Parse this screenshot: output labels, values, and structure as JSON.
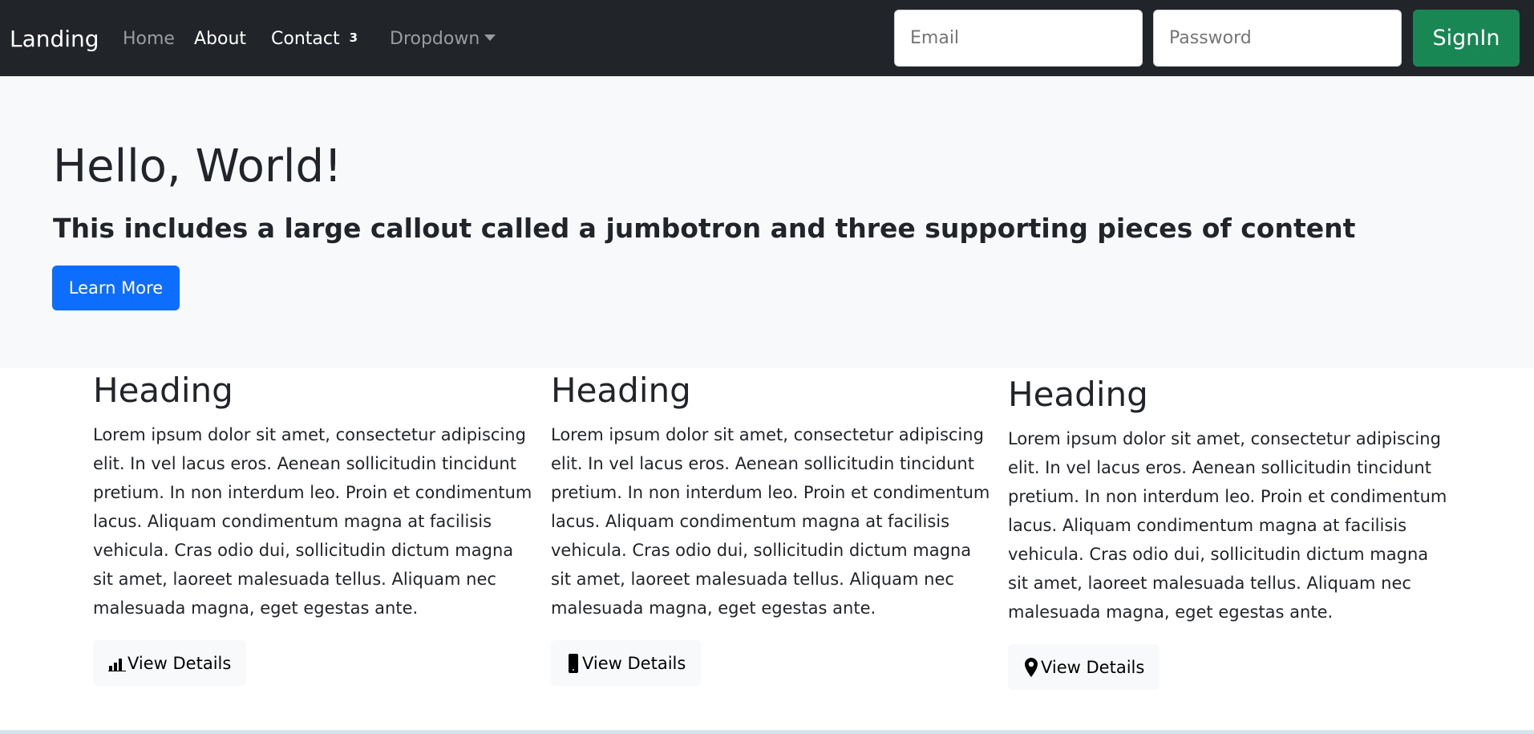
{
  "navbar": {
    "brand": "Landing",
    "links": [
      "Home",
      "About",
      "Contact",
      "Dropdown"
    ],
    "contact_badge": "3",
    "email_placeholder": "Email",
    "password_placeholder": "Password",
    "signin_label": "SignIn"
  },
  "jumbotron": {
    "title": "Hello, World!",
    "subtitle": "This includes a large callout called a jumbotron and three supporting pieces of content",
    "button": "Learn More"
  },
  "columns": [
    {
      "heading": "Heading",
      "text": "Lorem ipsum dolor sit amet, consectetur adipiscing elit. In vel lacus eros. Aenean sollicitudin tincidunt pretium. In non interdum leo. Proin et condimentum lacus. Aliquam condimentum magna at facilisis vehicula. Cras odio dui, sollicitudin dictum magna sit amet, laoreet malesuada tellus. Aliquam nec malesuada magna, eget egestas ante.",
      "button": "View Details",
      "icon": "bar-chart-icon"
    },
    {
      "heading": "Heading",
      "text": "Lorem ipsum dolor sit amet, consectetur adipiscing elit. In vel lacus eros. Aenean sollicitudin tincidunt pretium. In non interdum leo. Proin et condimentum lacus. Aliquam condimentum magna at facilisis vehicula. Cras odio dui, sollicitudin dictum magna sit amet, laoreet malesuada tellus. Aliquam nec malesuada magna, eget egestas ante.",
      "button": "View Details",
      "icon": "phone-icon"
    },
    {
      "heading": "Heading",
      "text": "Lorem ipsum dolor sit amet, consectetur adipiscing elit. In vel lacus eros. Aenean sollicitudin tincidunt pretium. In non interdum leo. Proin et condimentum lacus. Aliquam condimentum magna at facilisis vehicula. Cras odio dui, sollicitudin dictum magna sit amet, laoreet malesuada tellus. Aliquam nec malesuada magna, eget egestas ante.",
      "button": "View Details",
      "icon": "map-pin-icon"
    }
  ],
  "colors": {
    "navbar": "#212529",
    "primary": "#0d6efd",
    "success": "#198754",
    "jumbotron": "#f8f9fa"
  }
}
